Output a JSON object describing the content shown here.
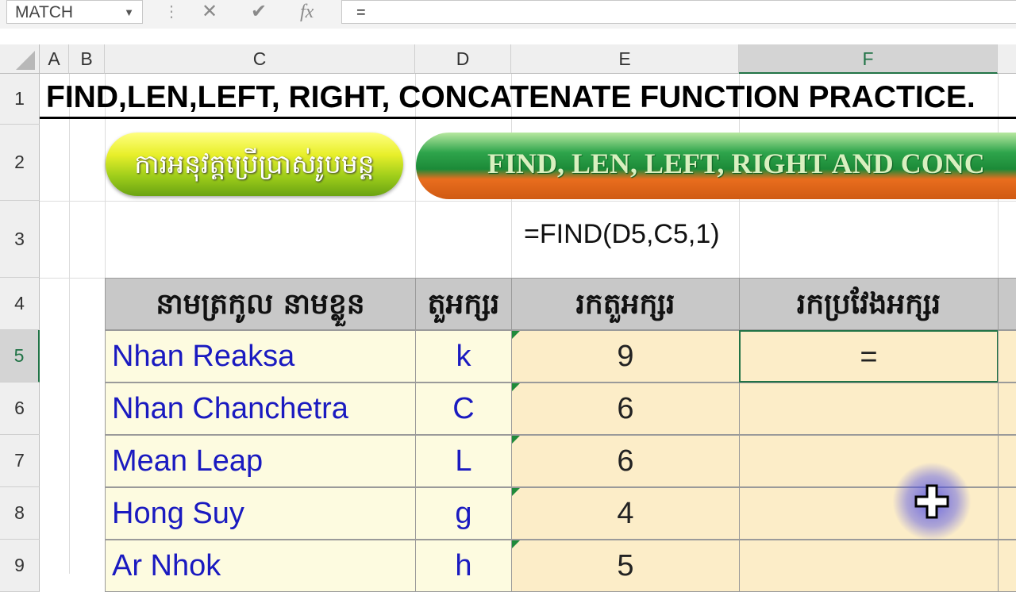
{
  "formula_bar": {
    "name_box": "MATCH",
    "cancel_icon": "✕",
    "enter_icon": "✔",
    "fx_label": "fx",
    "formula": "="
  },
  "columns": [
    "A",
    "B",
    "C",
    "D",
    "E",
    "F"
  ],
  "rows": [
    "1",
    "2",
    "3",
    "4",
    "5",
    "6",
    "7",
    "8",
    "9"
  ],
  "title": "FIND,LEN,LEFT, RIGHT, CONCATENATE FUNCTION PRACTICE.",
  "banner_khmer": "ការអនុវត្តប្រើប្រាស់រូបមន្ត",
  "banner_english": "FIND, LEN, LEFT, RIGHT AND CONC",
  "e3_formula": "=FIND(D5,C5,1)",
  "table": {
    "headers": [
      "នាមត្រកូល នាមខ្លួន",
      "តួអក្សរ",
      "រកតួអក្សរ",
      "រកប្រវែងអក្សរ"
    ],
    "rows": [
      {
        "name": "Nhan Reaksa",
        "char": "k",
        "find": "9",
        "len": "="
      },
      {
        "name": "Nhan Chanchetra",
        "char": "C",
        "find": "6",
        "len": ""
      },
      {
        "name": "Mean Leap",
        "char": "L",
        "find": "6",
        "len": ""
      },
      {
        "name": "Hong Suy",
        "char": "g",
        "find": "4",
        "len": ""
      },
      {
        "name": "Ar Nhok",
        "char": "h",
        "find": "5",
        "len": ""
      }
    ]
  },
  "colors": {
    "accent": "#217346",
    "name_text": "#1a1ac0"
  }
}
